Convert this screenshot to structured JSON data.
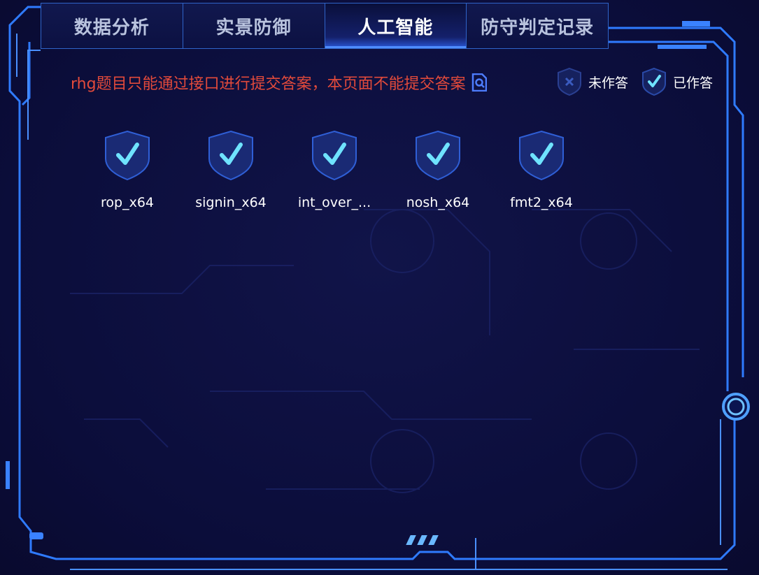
{
  "tabs": [
    {
      "label": "数据分析",
      "active": false
    },
    {
      "label": "实景防御",
      "active": false
    },
    {
      "label": "人工智能",
      "active": true
    },
    {
      "label": "防守判定记录",
      "active": false
    }
  ],
  "notice": {
    "text": "rhg题目只能通过接口进行提交答案，本页面不能提交答案",
    "color": "#e24a3b",
    "icon": "search-document-icon"
  },
  "legend": {
    "unanswered": {
      "label": "未作答",
      "icon": "shield-x-icon"
    },
    "answered": {
      "label": "已作答",
      "icon": "shield-check-icon"
    }
  },
  "challenges": [
    {
      "name": "rop_x64",
      "status": "answered"
    },
    {
      "name": "signin_x64",
      "status": "answered"
    },
    {
      "name": "int_over_...",
      "status": "answered"
    },
    {
      "name": "nosh_x64",
      "status": "answered"
    },
    {
      "name": "fmt2_x64",
      "status": "answered"
    }
  ],
  "colors": {
    "background": "#0b0d3a",
    "frame": "#2f7bff",
    "check": "#6fe3ff"
  }
}
